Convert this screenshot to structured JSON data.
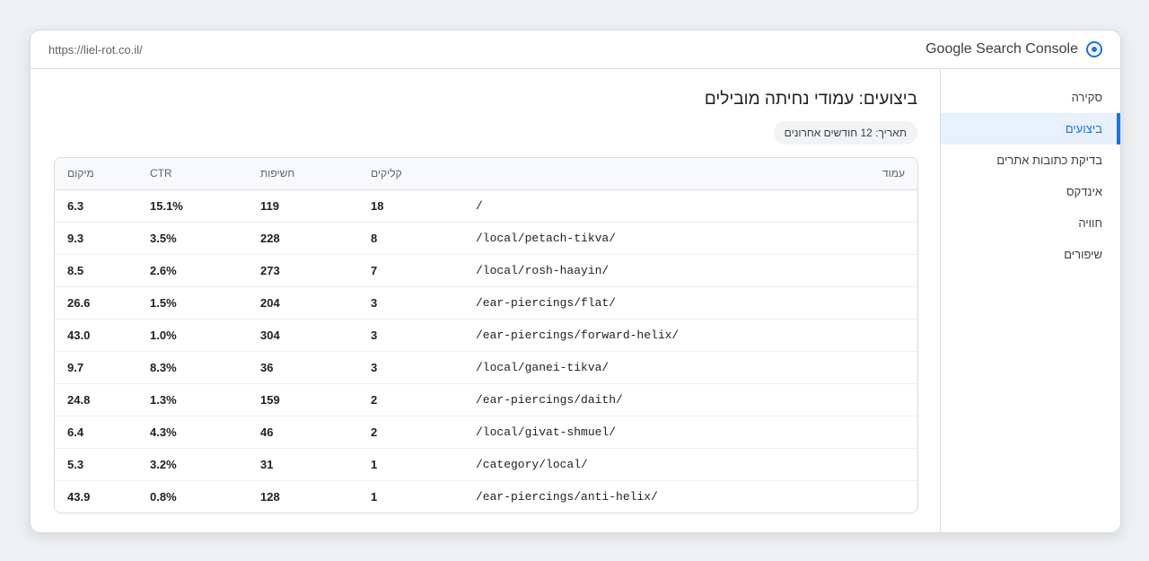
{
  "header": {
    "url": "https://liel-rot.co.il/",
    "brand": "Google Search Console",
    "logo_icon": "search-console-logo-icon"
  },
  "sidebar": {
    "items": [
      {
        "label": "סקירה",
        "active": false
      },
      {
        "label": "ביצועים",
        "active": true
      },
      {
        "label": "בדיקת כתובות אתרים",
        "active": false
      },
      {
        "label": "אינדקס",
        "active": false
      },
      {
        "label": "חוויה",
        "active": false
      },
      {
        "label": "שיפורים",
        "active": false
      }
    ]
  },
  "main": {
    "title": "ביצועים: עמודי נחיתה מובילים",
    "date_filter": "תאריך: 12 חודשים אחרונים"
  },
  "table": {
    "headers": {
      "position": "מיקום",
      "ctr": "CTR",
      "impressions": "חשיפות",
      "clicks": "קליקים",
      "page": "עמוד"
    },
    "rows": [
      {
        "position": "6.3",
        "ctr": "15.1%",
        "impressions": "119",
        "clicks": "18",
        "page": "/"
      },
      {
        "position": "9.3",
        "ctr": "3.5%",
        "impressions": "228",
        "clicks": "8",
        "page": "/local/petach-tikva/"
      },
      {
        "position": "8.5",
        "ctr": "2.6%",
        "impressions": "273",
        "clicks": "7",
        "page": "/local/rosh-haayin/"
      },
      {
        "position": "26.6",
        "ctr": "1.5%",
        "impressions": "204",
        "clicks": "3",
        "page": "/ear-piercings/flat/"
      },
      {
        "position": "43.0",
        "ctr": "1.0%",
        "impressions": "304",
        "clicks": "3",
        "page": "/ear-piercings/forward-helix/"
      },
      {
        "position": "9.7",
        "ctr": "8.3%",
        "impressions": "36",
        "clicks": "3",
        "page": "/local/ganei-tikva/"
      },
      {
        "position": "24.8",
        "ctr": "1.3%",
        "impressions": "159",
        "clicks": "2",
        "page": "/ear-piercings/daith/"
      },
      {
        "position": "6.4",
        "ctr": "4.3%",
        "impressions": "46",
        "clicks": "2",
        "page": "/local/givat-shmuel/"
      },
      {
        "position": "5.3",
        "ctr": "3.2%",
        "impressions": "31",
        "clicks": "1",
        "page": "/category/local/"
      },
      {
        "position": "43.9",
        "ctr": "0.8%",
        "impressions": "128",
        "clicks": "1",
        "page": "/ear-piercings/anti-helix/"
      }
    ]
  },
  "colors": {
    "accent": "#1a73e8",
    "active_bg": "#e8f0fe",
    "border": "#dadce0",
    "background": "#eef0f3"
  }
}
